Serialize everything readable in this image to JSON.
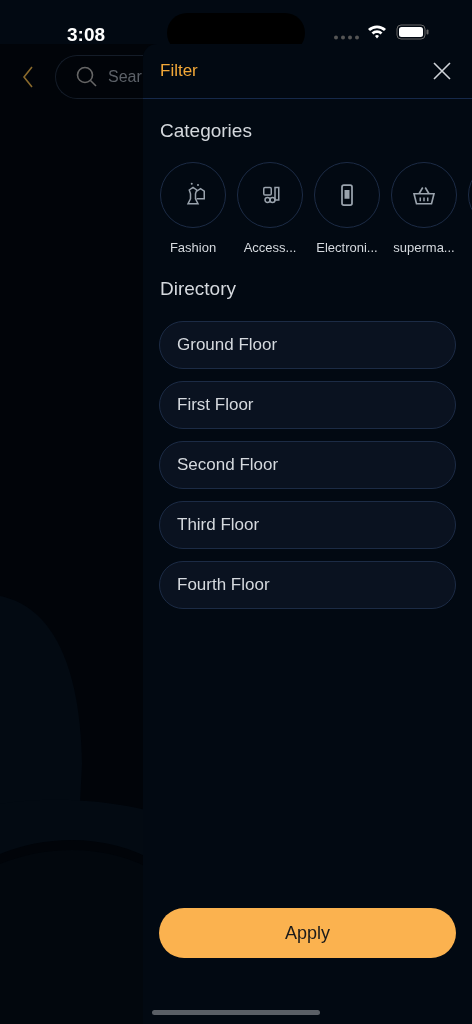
{
  "status_bar": {
    "time": "3:08"
  },
  "background": {
    "search": {
      "placeholder": "Sear"
    }
  },
  "filter": {
    "title": "Filter",
    "categories_title": "Categories",
    "categories": [
      {
        "label": "Fashion",
        "kind": "fashion"
      },
      {
        "label": "Access...",
        "kind": "accessories"
      },
      {
        "label": "Electroni...",
        "kind": "phone"
      },
      {
        "label": "superma...",
        "kind": "basket"
      }
    ],
    "directory_title": "Directory",
    "floors": [
      "Ground Floor",
      "First Floor",
      "Second Floor",
      "Third Floor",
      "Fourth Floor"
    ],
    "apply": "Apply"
  }
}
